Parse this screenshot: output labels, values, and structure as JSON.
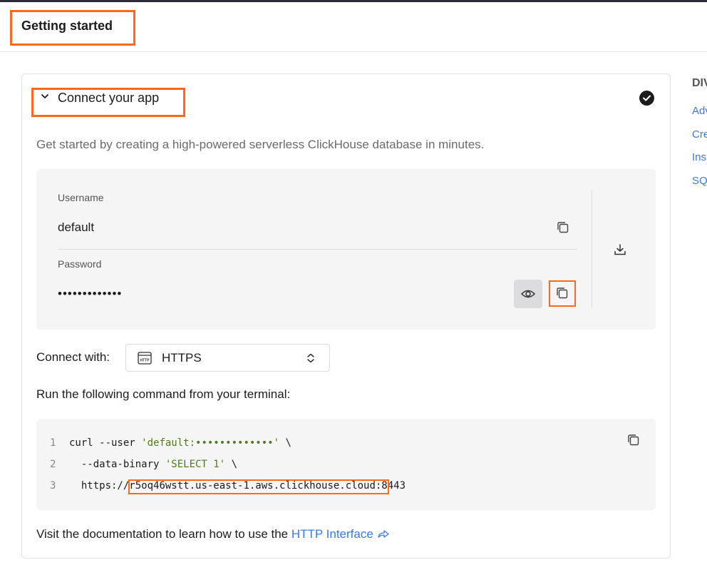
{
  "header": {
    "title": "Getting started"
  },
  "section": {
    "title": "Connect your app",
    "subtitle": "Get started by creating a high-powered serverless ClickHouse database in minutes."
  },
  "credentials": {
    "username_label": "Username",
    "username_value": "default",
    "password_label": "Password",
    "password_value": "•••••••••••••"
  },
  "connect": {
    "label": "Connect with:",
    "selected": "HTTPS",
    "icon_text": "HTTP"
  },
  "terminal": {
    "instruction": "Run the following command from your terminal:",
    "lines": [
      {
        "num": "1",
        "pre": "curl --user ",
        "str": "'default:•••••••••••••'",
        "post": " \\"
      },
      {
        "num": "2",
        "pre": "  --data-binary ",
        "str": "'SELECT 1'",
        "post": " \\"
      },
      {
        "num": "3",
        "pre": "  https://",
        "str": "",
        "host": "r5oq46wstt.us-east-1.aws.clickhouse.cloud",
        "post": ":8443"
      }
    ]
  },
  "docs": {
    "prefix": "Visit the documentation to learn how to use the ",
    "link": "HTTP Interface"
  },
  "sidebar": {
    "heading": "DIV",
    "links": [
      "Adv",
      "Cre",
      "Ins",
      "SQ"
    ]
  },
  "colors": {
    "highlight": "#ff6a1a",
    "link": "#3b78e7",
    "string": "#4f7a1f"
  }
}
